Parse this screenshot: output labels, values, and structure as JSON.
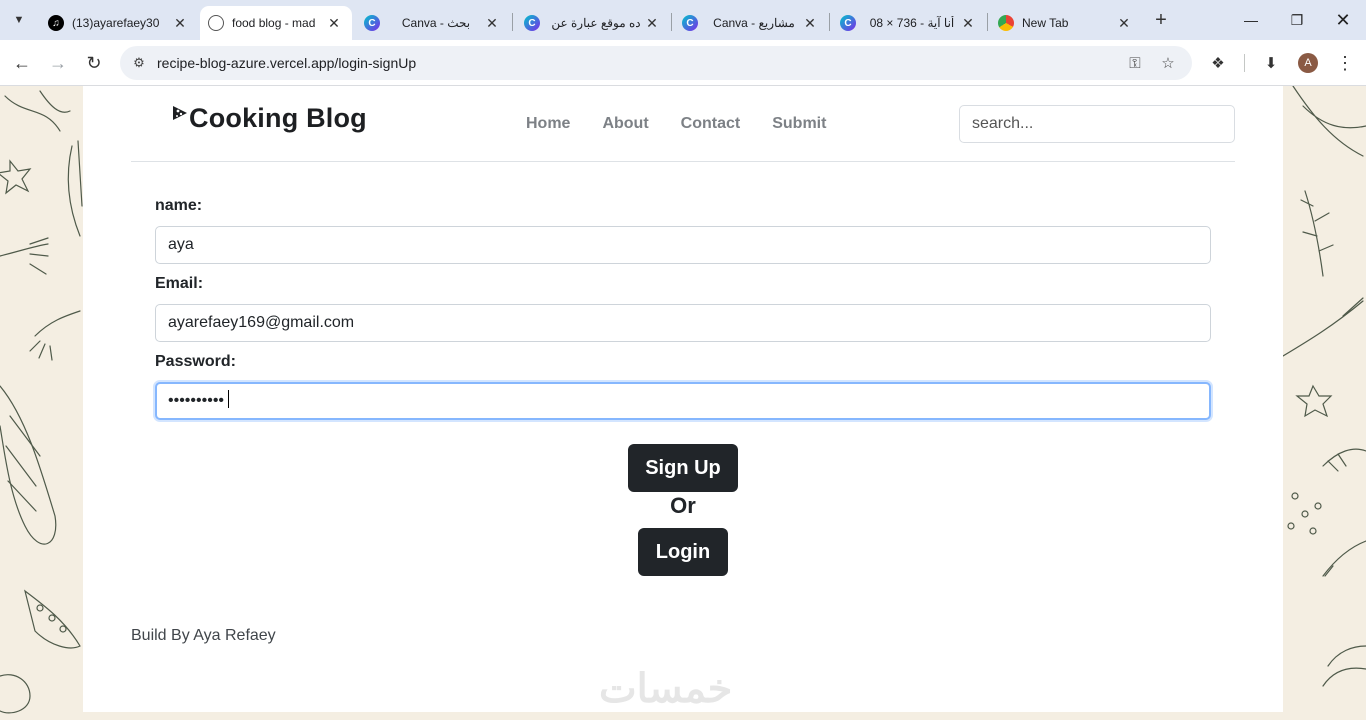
{
  "browser": {
    "tabs": [
      {
        "title": "(13)ayarefaey30",
        "favicon": "tiktok-icon",
        "active": false
      },
      {
        "title": "food blog - mad",
        "favicon": "globe-icon",
        "active": true
      },
      {
        "title": "Canva - بحث",
        "favicon": "canva-icon",
        "active": false
      },
      {
        "title": "ده موقع عبارة عن",
        "favicon": "canva-icon",
        "active": false
      },
      {
        "title": "Canva - مشاريع",
        "favicon": "canva-icon",
        "active": false
      },
      {
        "title": "أنا آية - 736 × 08",
        "favicon": "canva-icon",
        "active": false
      },
      {
        "title": "New Tab",
        "favicon": "chrome-icon",
        "active": false
      }
    ],
    "url": "recipe-blog-azure.vercel.app/login-signUp",
    "profile_initial": "A"
  },
  "site": {
    "brand": "Cooking Blog",
    "nav": [
      "Home",
      "About",
      "Contact",
      "Submit"
    ],
    "search_placeholder": "search..."
  },
  "form": {
    "name_label": "name:",
    "name_value": "aya",
    "email_label": "Email:",
    "email_value": "ayarefaey169@gmail.com",
    "password_label": "Password:",
    "password_value": "••••••••••",
    "signup_button": "Sign Up",
    "or_text": "Or",
    "login_button": "Login"
  },
  "footer": {
    "credit": "Build By Aya Refaey"
  },
  "watermark": "خمسات",
  "colors": {
    "button_dark": "#212529",
    "nav_link": "#7d8186",
    "focus_ring": "#86b7fe",
    "page_background": "#f4eee2"
  }
}
